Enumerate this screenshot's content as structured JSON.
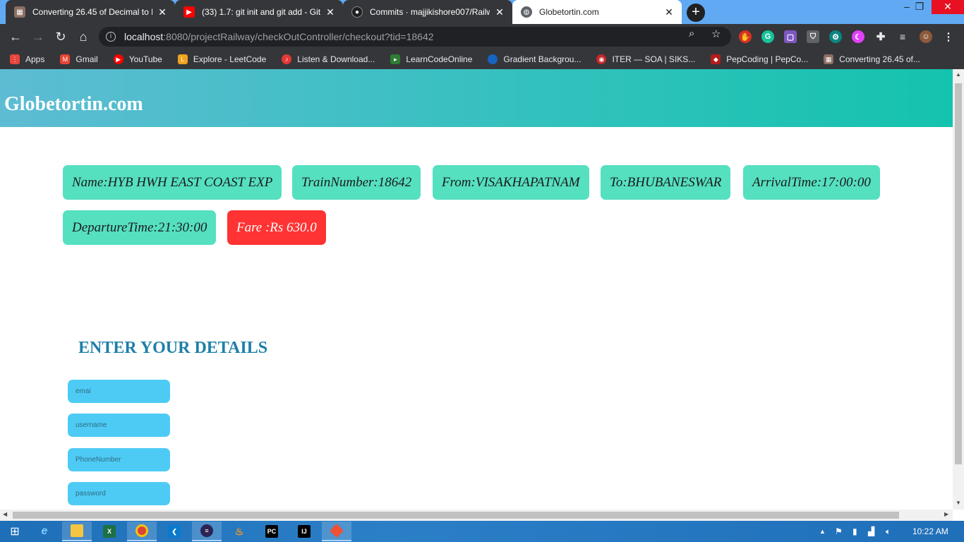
{
  "browser": {
    "tabs": [
      {
        "title": "Converting 26.45 of Decimal to B",
        "favicon": "calculator-icon",
        "active": false
      },
      {
        "title": "(33) 1.7: git init and git add - Git",
        "favicon": "youtube-icon",
        "active": false
      },
      {
        "title": "Commits · majjikishore007/Railw",
        "favicon": "github-icon",
        "active": false
      },
      {
        "title": "Globetortin.com",
        "favicon": "globe-icon",
        "active": true
      }
    ],
    "url_host": "localhost",
    "url_path": ":8080/projectRailway/checkOutController/checkout?tid=18642",
    "bookmarks": [
      {
        "label": "Apps",
        "icon": "apps-grid-icon",
        "color": "#e8453c"
      },
      {
        "label": "Gmail",
        "icon": "gmail-icon",
        "color": "#ea4335"
      },
      {
        "label": "YouTube",
        "icon": "youtube-icon",
        "color": "#ff0000"
      },
      {
        "label": "Explore - LeetCode",
        "icon": "leetcode-icon",
        "color": "#f0a31e"
      },
      {
        "label": "Listen & Download...",
        "icon": "music-icon",
        "color": "#e53935"
      },
      {
        "label": "LearnCodeOnline",
        "icon": "lco-icon",
        "color": "#2e7d32"
      },
      {
        "label": "Gradient Backgrou...",
        "icon": "gradient-icon",
        "color": "#1565c0"
      },
      {
        "label": "ITER — SOA | SIKS...",
        "icon": "iter-icon",
        "color": "#c62828"
      },
      {
        "label": "PepCoding | PepCo...",
        "icon": "pepcoding-icon",
        "color": "#b71c1c"
      },
      {
        "label": "Converting 26.45 of...",
        "icon": "calculator-icon",
        "color": "#8d6e63"
      }
    ]
  },
  "page": {
    "site_title": "Globetortin.com",
    "train": {
      "name": "Name:HYB HWH EAST COAST EXP",
      "number": "TrainNumber:18642",
      "from": "From:VISAKHAPATNAM",
      "to": "To:BHUBANESWAR",
      "arrival": "ArrivalTime:17:00:00",
      "departure": "DepartureTime:21:30:00",
      "fare": "Fare :Rs 630.0"
    },
    "details_heading": "ENTER YOUR DETAILS",
    "form": {
      "email_placeholder": "emai",
      "username_placeholder": "username",
      "phone_placeholder": "PhoneNumber",
      "password_placeholder": "password"
    }
  },
  "taskbar": {
    "clock": "10:22 AM"
  },
  "colors": {
    "header_gradient_start": "#5dbcd3",
    "header_gradient_end": "#14c3ae",
    "info_box": "#55e0c0",
    "fare_box": "#ff3333",
    "heading": "#1d7fa8",
    "input": "#4ecbf5"
  }
}
